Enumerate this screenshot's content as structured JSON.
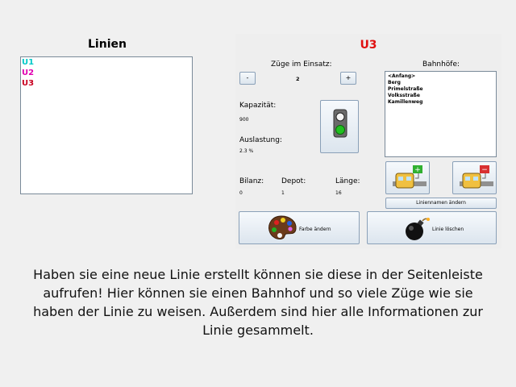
{
  "left_panel": {
    "title": "Linien",
    "lines": [
      {
        "label": "U1",
        "color": "#00c8c8"
      },
      {
        "label": "U2",
        "color": "#e000b0"
      },
      {
        "label": "U3",
        "color": "#c80020"
      }
    ]
  },
  "line_detail": {
    "title": "U3",
    "title_color": "#e01010",
    "trains_label": "Züge im Einsatz:",
    "trains_value": "2",
    "minus_label": "-",
    "plus_label": "+",
    "capacity_label": "Kapazität:",
    "capacity_value": "900",
    "load_label": "Auslastung:",
    "load_value": "2.3 %",
    "balance_label": "Bilanz:",
    "balance_value": "0",
    "depot_label": "Depot:",
    "depot_value": "1",
    "length_label": "Länge:",
    "length_value": "16",
    "stations_label": "Bahnhöfe:",
    "stations": [
      "<Anfang>",
      "Berg",
      "Primelstraße",
      "Volksstraße",
      "Kamillenweg"
    ],
    "rename_label": "Liniennamen ändern",
    "color_button_label": "Farbe ändern",
    "delete_button_label": "Linie löschen",
    "signal_icon": "traffic-light-icon",
    "add_train_icon": "train-plus-icon",
    "remove_train_icon": "train-minus-icon",
    "palette_icon": "palette-icon",
    "bomb_icon": "bomb-icon"
  },
  "caption": "Haben sie eine neue Linie erstellt können sie diese in der Seitenleiste aufrufen! Hier können sie einen Bahnhof und so viele Züge wie sie haben der Linie zu weisen. Außerdem sind hier alle Informationen zur Linie gesammelt."
}
